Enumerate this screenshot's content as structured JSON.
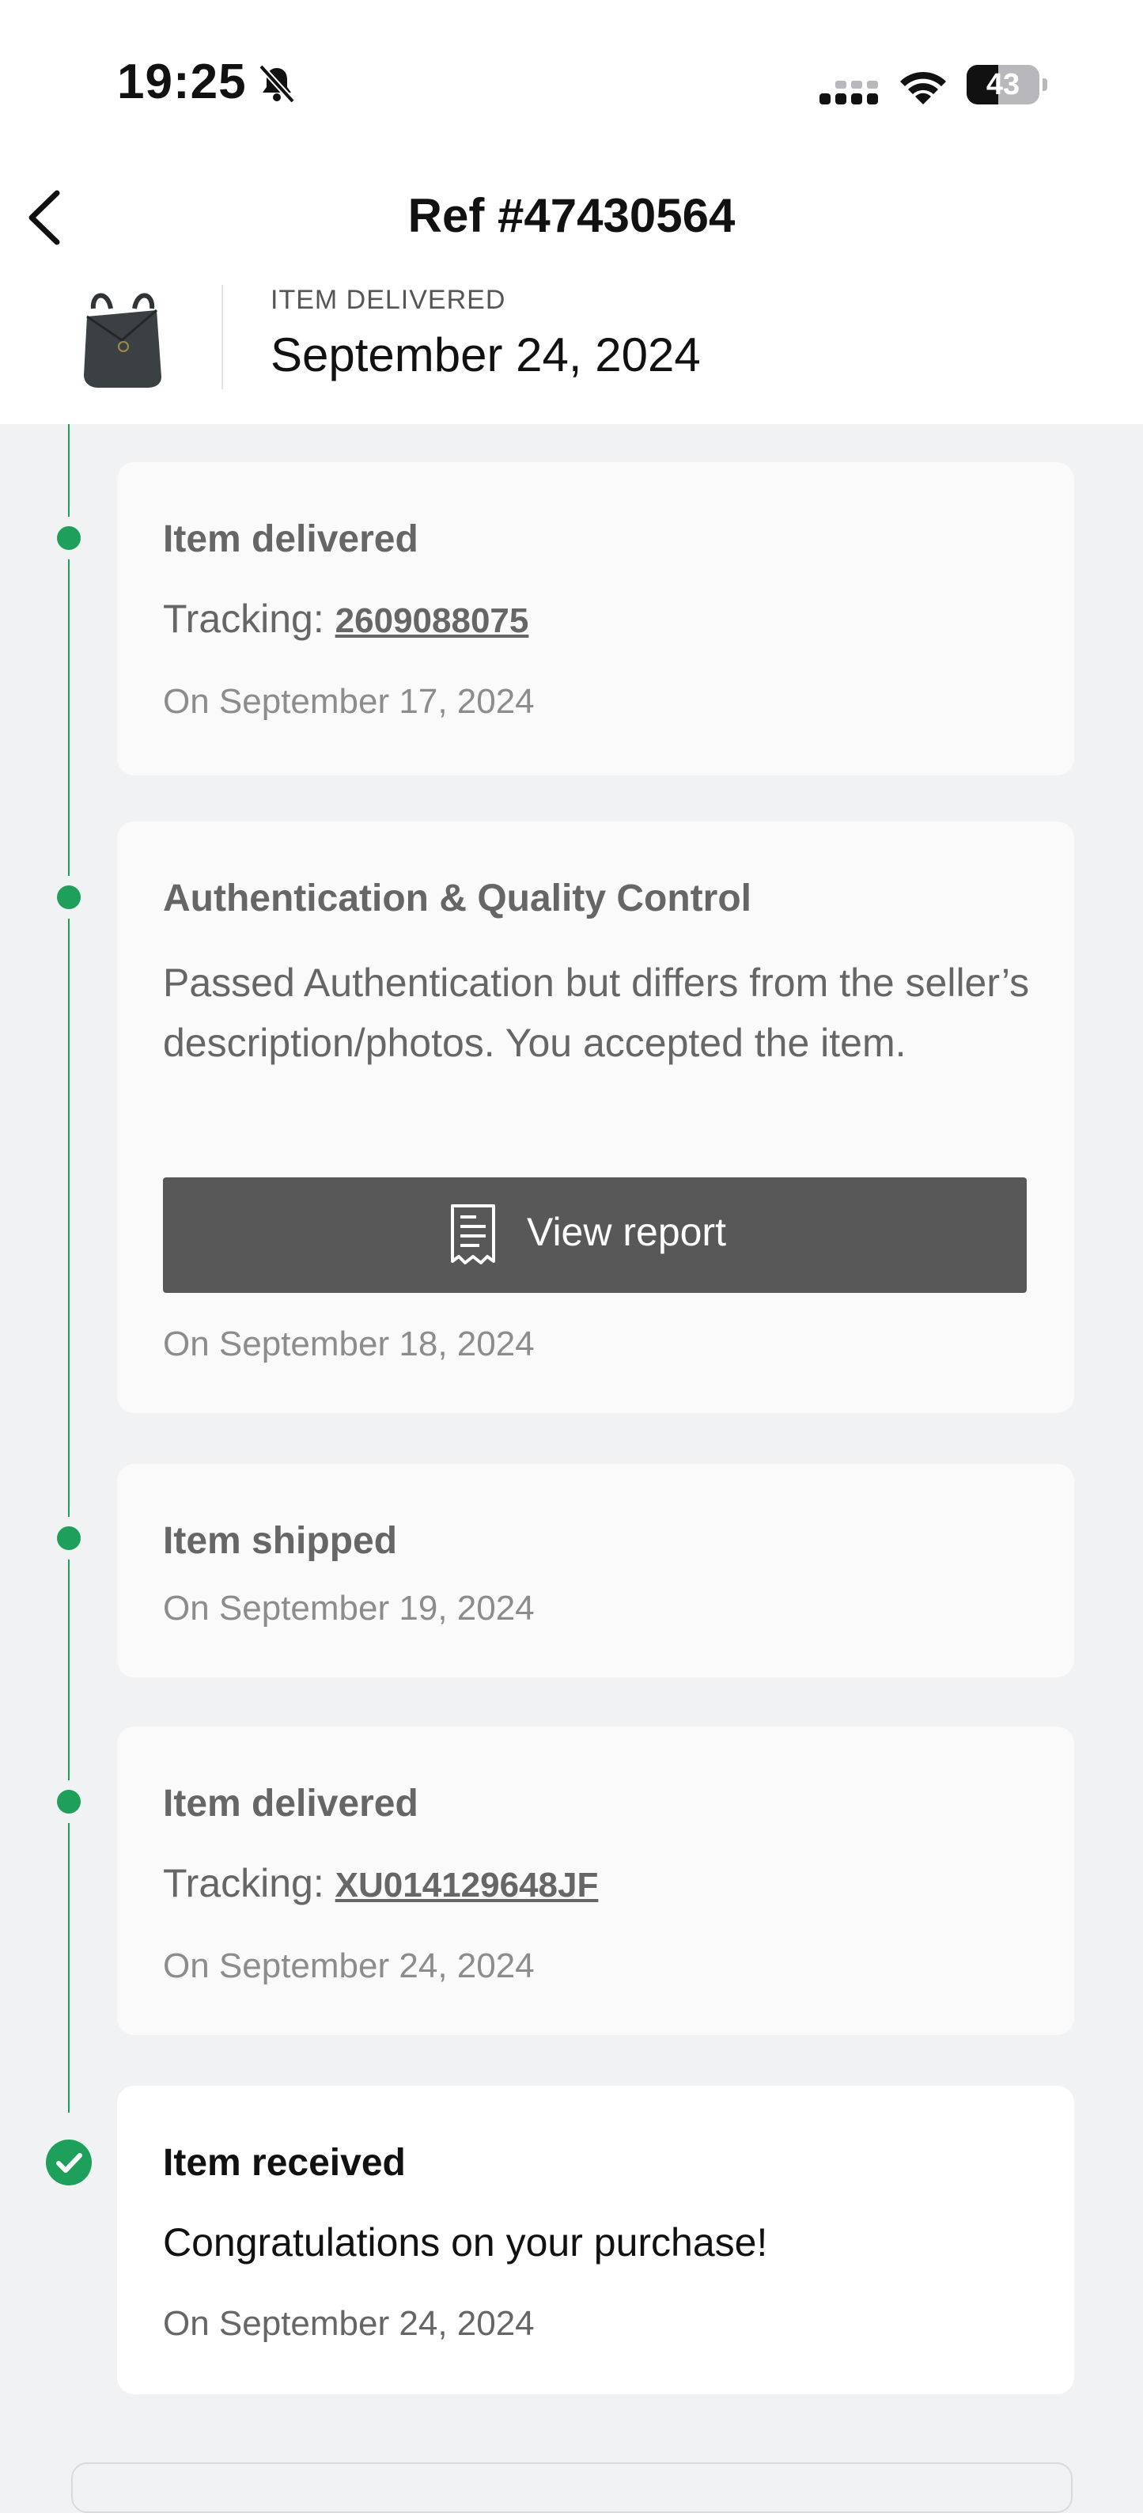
{
  "status_bar": {
    "time": "19:25",
    "battery": "43",
    "battery_level": 0.43,
    "icons": [
      "bell-slash-icon",
      "signal-icon",
      "wifi-icon",
      "battery-icon"
    ]
  },
  "header": {
    "title": "Ref #47430564",
    "back_icon": "chevron-left-icon"
  },
  "summary": {
    "status_label": "ITEM DELIVERED",
    "date": "September 24, 2024"
  },
  "timeline": [
    {
      "title": "Item delivered",
      "tracking_prefix": "Tracking: ",
      "tracking_number": "2609088075",
      "date": "On September 17, 2024"
    },
    {
      "title": "Authentication & Quality Control",
      "description": "Passed Authentication but differs from the seller’s description/photos. You accepted the item.",
      "button_label": "View report",
      "button_icon": "receipt-icon",
      "date": "On September 18, 2024"
    },
    {
      "title": "Item shipped",
      "date": "On September 19, 2024"
    },
    {
      "title": "Item delivered",
      "tracking_prefix": "Tracking: ",
      "tracking_number": "XU014129648JF",
      "date": "On September 24, 2024"
    },
    {
      "title": "Item received",
      "description": "Congratulations on your purchase!",
      "date": "On September 24, 2024",
      "status_icon": "check-circle-icon"
    }
  ],
  "colors": {
    "accent_green": "#1ea05b",
    "button_dark": "#585858",
    "background": "#f1f2f4"
  }
}
